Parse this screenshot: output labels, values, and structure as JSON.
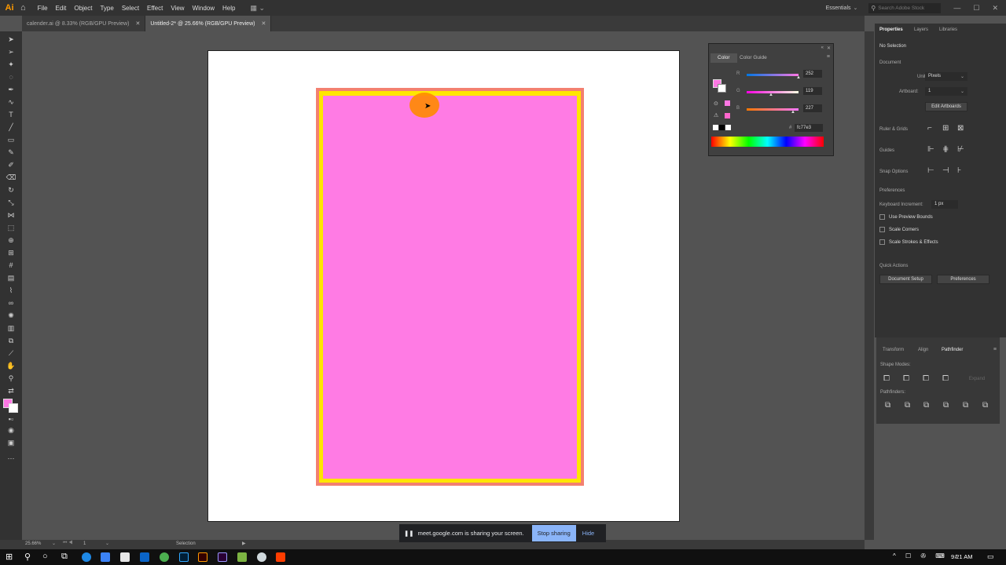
{
  "app": {
    "logo": "Ai",
    "workspace": "Essentials",
    "search_placeholder": "Search Adobe Stock"
  },
  "menu": [
    "File",
    "Edit",
    "Object",
    "Type",
    "Select",
    "Effect",
    "View",
    "Window",
    "Help"
  ],
  "tabs": [
    {
      "label": "calender.ai @ 8.33% (RGB/GPU Preview)",
      "active": false
    },
    {
      "label": "Untitled-2* @ 25.66% (RGB/GPU Preview)",
      "active": true
    }
  ],
  "color_panel": {
    "tab1": "Color",
    "tab2": "Color Guide",
    "r_label": "R",
    "r_value": "252",
    "g_label": "G",
    "g_value": "119",
    "b_label": "B",
    "b_value": "227",
    "hex_label": "#",
    "hex_value": "fc77e3",
    "fill_color": "#fc77e3"
  },
  "properties": {
    "tabs": [
      "Properties",
      "Layers",
      "Libraries"
    ],
    "no_selection": "No Selection",
    "document": "Document",
    "units_label": "Units:",
    "units_value": "Pixels",
    "artboard_label": "Artboard:",
    "artboard_value": "1",
    "edit_artboards": "Edit Artboards",
    "ruler_grids": "Ruler & Grids",
    "guides": "Guides",
    "snap_options": "Snap Options",
    "preferences_header": "Preferences",
    "keyboard_increment_label": "Keyboard Increment:",
    "keyboard_increment_value": "1 px",
    "use_preview_bounds": "Use Preview Bounds",
    "scale_corners": "Scale Corners",
    "scale_strokes": "Scale Strokes & Effects",
    "quick_actions": "Quick Actions",
    "document_setup": "Document Setup",
    "preferences_btn": "Preferences"
  },
  "pathfinder_panel": {
    "tabs": [
      "Transform",
      "Align",
      "Pathfinder"
    ],
    "shape_modes": "Shape Modes:",
    "expand": "Expand",
    "pathfinders": "Pathfinders:"
  },
  "status": {
    "zoom": "25.66%",
    "artboard": "1",
    "tool": "Selection"
  },
  "share_bar": {
    "message": "meet.google.com is sharing your screen.",
    "stop": "Stop sharing",
    "hide": "Hide"
  },
  "taskbar": {
    "time": "9:21 AM"
  }
}
